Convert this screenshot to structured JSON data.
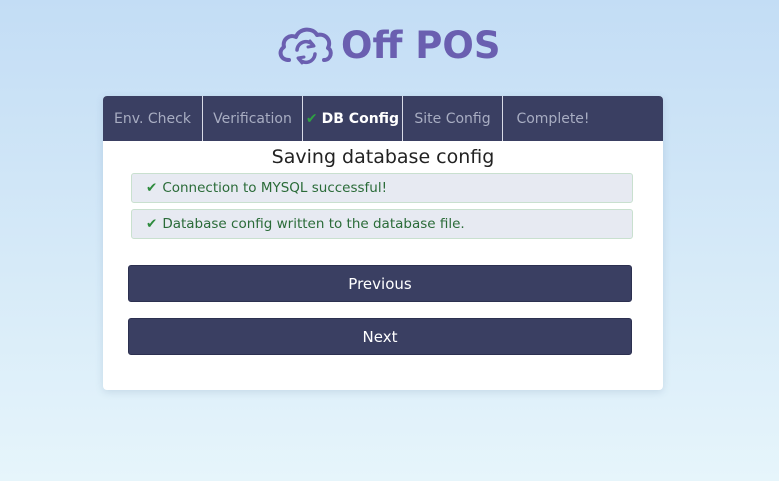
{
  "brand": {
    "logo_text": "Off POS",
    "logo_color": "#6a5fb0"
  },
  "steps": [
    {
      "label": "Env. Check",
      "state": "done"
    },
    {
      "label": "Verification",
      "state": "done"
    },
    {
      "label": "DB Config",
      "state": "active",
      "icon": "check-icon"
    },
    {
      "label": "Site Config",
      "state": "pending"
    },
    {
      "label": "Complete!",
      "state": "pending"
    }
  ],
  "main": {
    "title": "Saving database config",
    "messages": [
      {
        "icon": "check-icon",
        "text": "Connection to MYSQL successful!"
      },
      {
        "icon": "check-icon",
        "text": "Database config written to the database file."
      }
    ],
    "previous_label": "Previous",
    "next_label": "Next"
  },
  "colors": {
    "nav_bg": "#3a3f62",
    "success": "#2e8b3e",
    "button_bg": "#3a3f62"
  }
}
